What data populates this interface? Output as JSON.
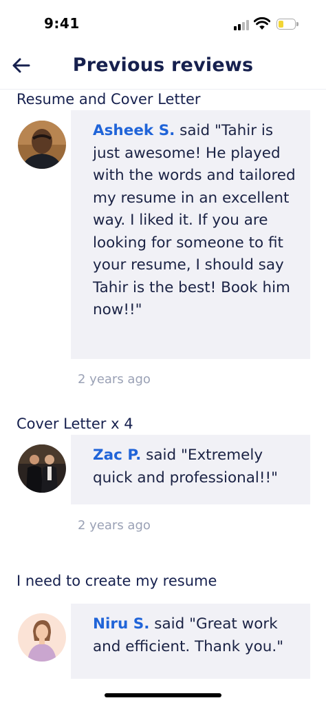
{
  "status_bar": {
    "time": "9:41",
    "icons": [
      "signal-icon",
      "wifi-icon",
      "battery-icon"
    ]
  },
  "header": {
    "back_icon": "arrow-left-icon",
    "title": "Previous reviews"
  },
  "reviews": [
    {
      "service": "Resume and Cover Letter",
      "reviewer": "Asheek  S.",
      "text": " said \"Tahir is just awesome! He played with the words and tailored my resume in an excellent way. I liked it. If you are looking for someone to fit your resume, I should say Tahir is the best! Book him now!!\"",
      "time_ago": "2 years ago"
    },
    {
      "service": "Cover Letter x 4",
      "reviewer": "Zac P.",
      "text": " said \"Extremely quick and professional!!\"",
      "time_ago": "2 years ago"
    },
    {
      "service": "I need to create my resume",
      "reviewer": "Niru S.",
      "text": " said \"Great work and efficient.  Thank you.\"",
      "time_ago": ""
    }
  ],
  "colors": {
    "title": "#16204e",
    "reviewer_name": "#2064d8",
    "bubble_bg": "#f1f1f6",
    "muted": "#9aa1b5"
  }
}
